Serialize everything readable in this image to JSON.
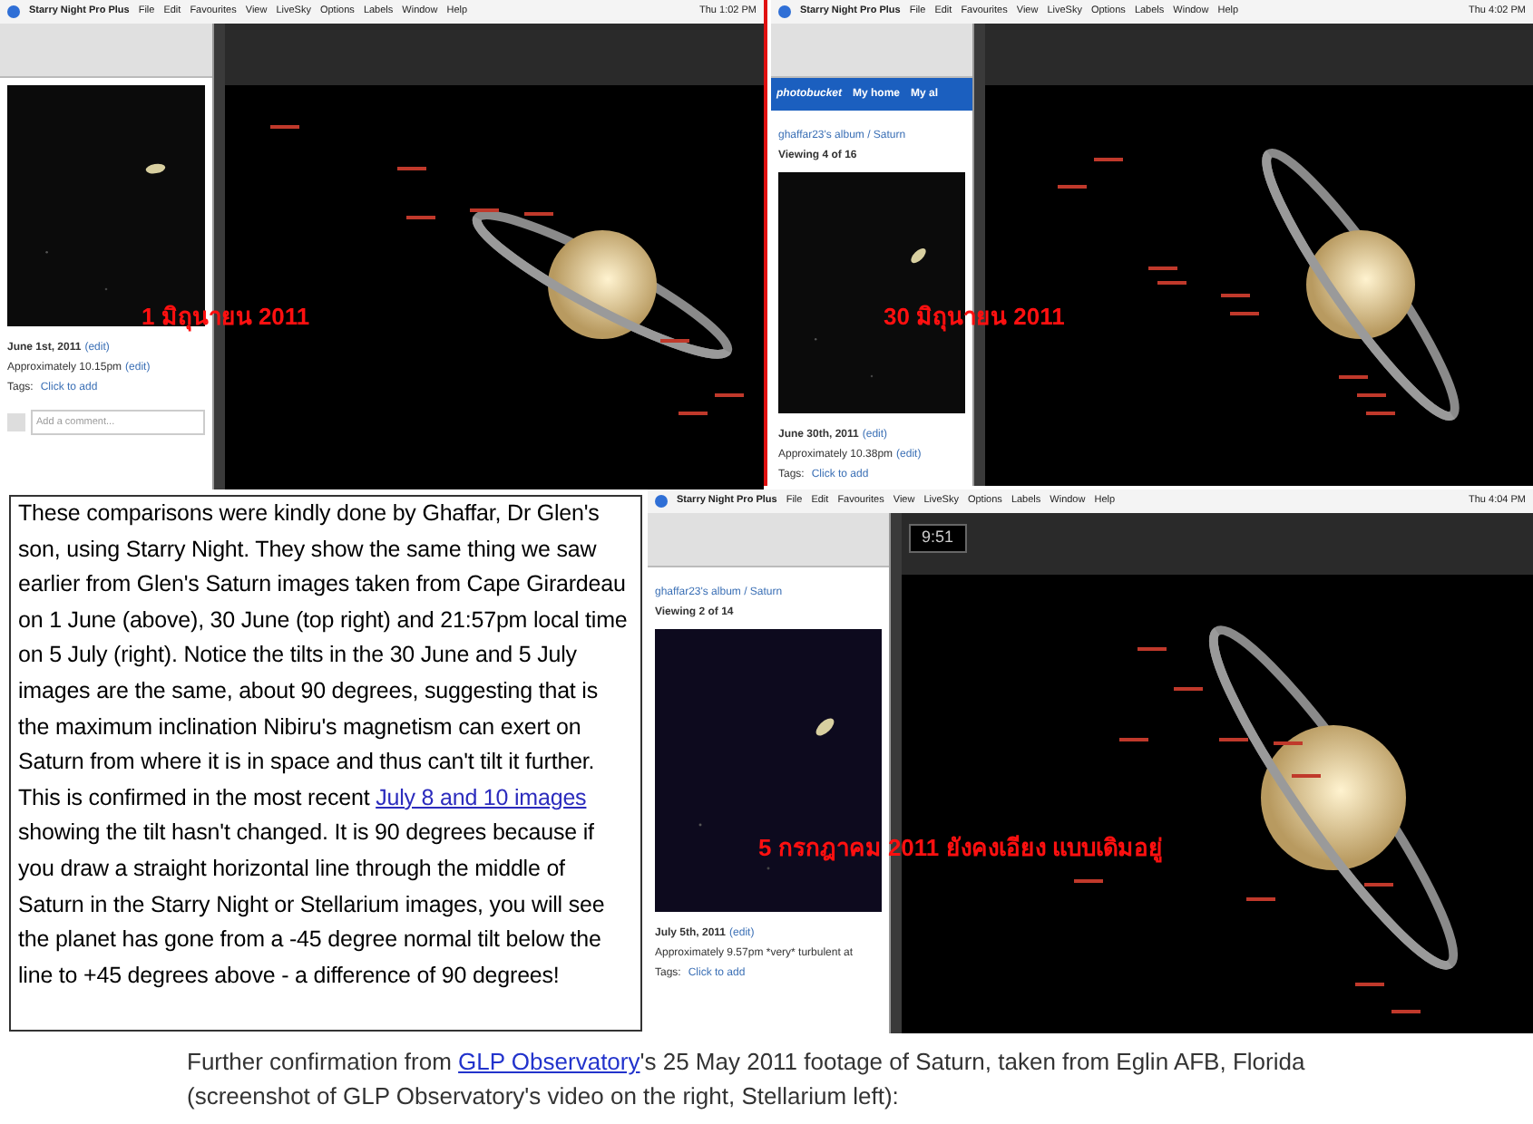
{
  "screenshots": [
    {
      "menu_bar": {
        "app": "Starry Night Pro Plus",
        "menus": [
          "File",
          "Edit",
          "Favourites",
          "View",
          "LiveSky",
          "Options",
          "Labels",
          "Window",
          "Help"
        ],
        "clock": "Thu 1:02 PM"
      },
      "browser": {
        "caption_date": "June 1st, 2011",
        "edit": "(edit)",
        "time_note": "Approximately 10.15pm",
        "time_edit": "(edit)",
        "tags_label": "Tags:",
        "tags_link": "Click to add",
        "comment_placeholder": "Add a comment..."
      },
      "overlay": "1 มิถุนายน 2011"
    },
    {
      "menu_bar": {
        "app": "Starry Night Pro Plus",
        "menus": [
          "File",
          "Edit",
          "Favourites",
          "View",
          "LiveSky",
          "Options",
          "Labels",
          "Window",
          "Help"
        ],
        "clock": "Thu 4:02 PM"
      },
      "browser": {
        "header": {
          "logo": "photobucket",
          "links": [
            "My home",
            "My al"
          ]
        },
        "album": "ghaffar23's album / Saturn",
        "viewing": "Viewing 4 of 16",
        "caption_date": "June 30th, 2011",
        "edit": "(edit)",
        "time_note": "Approximately 10.38pm",
        "time_edit": "(edit)",
        "tags_label": "Tags:",
        "tags_link": "Click to add"
      },
      "overlay": "30 มิถุนายน 2011"
    },
    {
      "menu_bar": {
        "app": "Starry Night Pro Plus",
        "menus": [
          "File",
          "Edit",
          "Favourites",
          "View",
          "LiveSky",
          "Options",
          "Labels",
          "Window",
          "Help"
        ],
        "clock": "Thu 4:04 PM"
      },
      "toolbar_time": "9:51",
      "browser": {
        "album": "ghaffar23's album / Saturn",
        "viewing": "Viewing 2 of 14",
        "caption_date": "July 5th, 2011",
        "edit": "(edit)",
        "time_note": "Approximately 9.57pm *very* turbulent at",
        "tags_label": "Tags:",
        "tags_link": "Click to add"
      },
      "overlay": "5 กรกฎาคม 2011 ยังคงเอียง แบบเดิมอยู่"
    }
  ],
  "paragraph": {
    "before": "These comparisons were kindly done by Ghaffar, Dr Glen's son, using Starry Night. They show the same thing we saw earlier from Glen's Saturn images taken from Cape Girardeau on 1 June (above), 30 June (top right) and 21:57pm local time on 5 July (right). Notice the tilts in the 30 June and 5 July images are the same, about 90 degrees, suggesting that is the maximum inclination Nibiru's magnetism can exert on Saturn from where it is in space and thus can't tilt it further. This is confirmed in the most recent ",
    "link": "July 8 and 10 images",
    "after": " showing the tilt hasn't changed. It is 90 degrees because if you draw a straight horizontal line through the middle of Saturn in the Starry Night or Stellarium images, you will see the planet has gone from a -45 degree normal tilt below the line to +45 degrees above -  a difference of 90 degrees!"
  },
  "footer": {
    "before": "Further confirmation from ",
    "link": "GLP Observatory",
    "after": "'s 25 May 2011 footage of Saturn, taken from Eglin AFB, Florida (screenshot of GLP Observatory's video on the right, Stellarium left):"
  }
}
